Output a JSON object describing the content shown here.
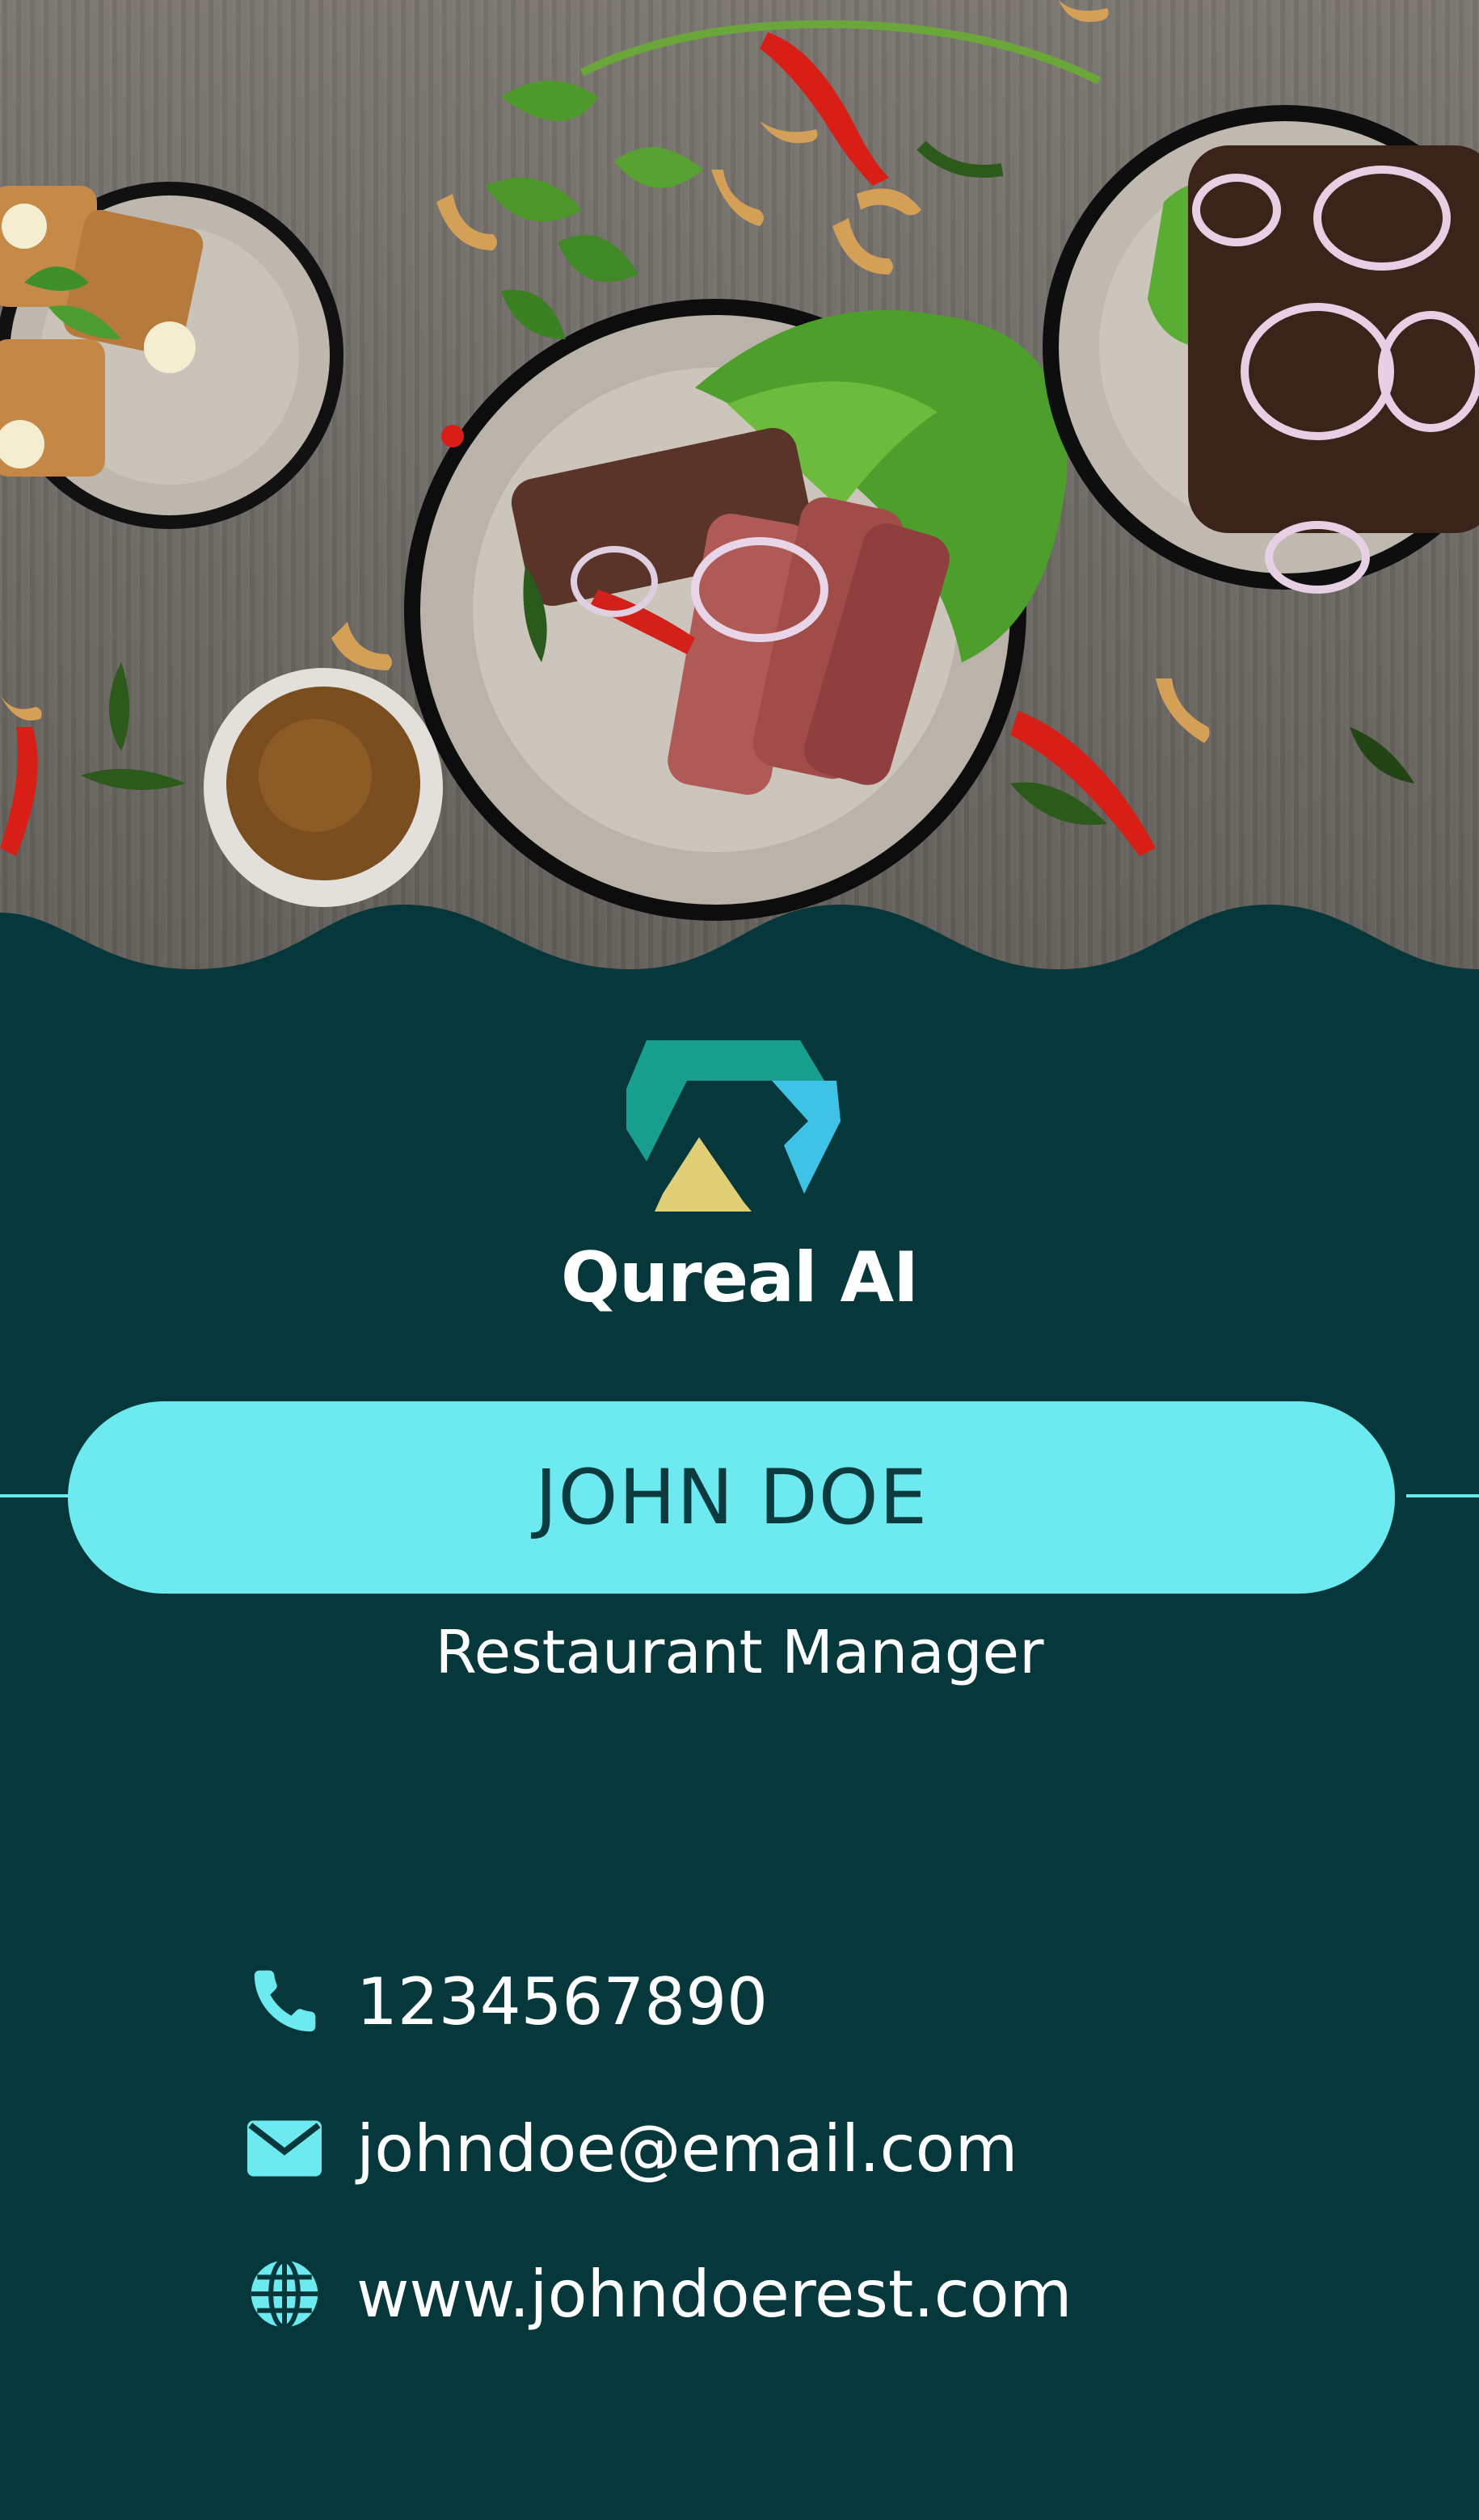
{
  "brand": {
    "name": "Qureal AI"
  },
  "person": {
    "name": "JOHN DOE",
    "title": "Restaurant Manager"
  },
  "contacts": {
    "phone": {
      "icon": "phone-icon",
      "value": "1234567890"
    },
    "email": {
      "icon": "envelope-icon",
      "value": "johndoe@email.com"
    },
    "website": {
      "icon": "globe-icon",
      "value": "www.johndoerest.com"
    }
  },
  "colors": {
    "background": "#06383b",
    "accent": "#6deaf0",
    "logo_teal": "#1a9e8f",
    "logo_blue": "#3ec3e6",
    "logo_yellow": "#e1cf77"
  }
}
